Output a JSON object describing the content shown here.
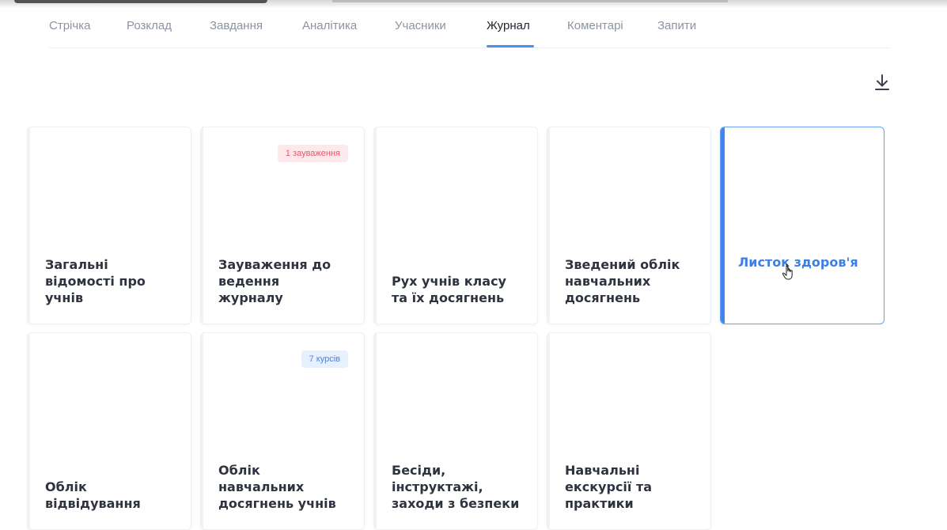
{
  "tabs": [
    {
      "label": "Стрічка",
      "active": false
    },
    {
      "label": "Розклад",
      "active": false
    },
    {
      "label": "Завдання",
      "active": false
    },
    {
      "label": "Аналітика",
      "active": false
    },
    {
      "label": "Учасники",
      "active": false
    },
    {
      "label": "Журнал",
      "active": true
    },
    {
      "label": "Коментарі",
      "active": false
    },
    {
      "label": "Запити",
      "active": false
    }
  ],
  "toolbar": {
    "download_icon": "download-icon"
  },
  "cards": [
    {
      "title": "Загальні\nвідомості про\nучнів",
      "badge": ""
    },
    {
      "title": "Зауваження до\nведення\nжурналу",
      "badge": "1 зауваження",
      "badge_color": "#e8566b"
    },
    {
      "title": "Рух учнів класу\nта їх досягнень",
      "badge": ""
    },
    {
      "title": "Зведений облік\nнавчальних\nдосягнень",
      "badge": ""
    },
    {
      "title": "Листок здоров'я",
      "badge": "",
      "selected": true
    },
    {
      "title": "Облік\nвідвідування",
      "badge": ""
    },
    {
      "title": "Облік\nнавчальних\nдосягнень учнів",
      "badge": "7 курсів",
      "badge_color": "#4a82e6"
    },
    {
      "title": "Бесіди,\nінструктажі,\nзаходи з безпеки",
      "badge": ""
    },
    {
      "title": "Навчальні\nекскурсії та\nпрактики",
      "badge": ""
    }
  ],
  "colors": {
    "accent": "#3d86f2",
    "text": "#2e3340",
    "muted": "#8c93a3"
  }
}
